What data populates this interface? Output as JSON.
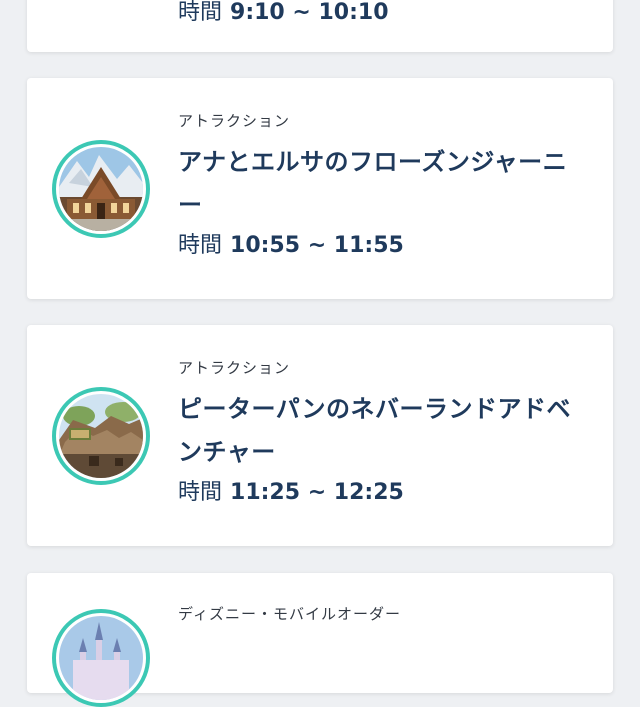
{
  "schedule": {
    "items": [
      {
        "time_label": "時間",
        "time_value": "9:10 ~ 10:10"
      },
      {
        "category": "アトラクション",
        "title": "アナとエルサのフローズンジャーニー",
        "time_label": "時間",
        "time_value": "10:55 ~ 11:55",
        "image_icon": "frozen-castle-image"
      },
      {
        "category": "アトラクション",
        "title": "ピーターパンのネバーランドアドベンチャー",
        "time_label": "時間",
        "time_value": "11:25 ~ 12:25",
        "image_icon": "neverland-ride-image"
      },
      {
        "category": "ディズニー・モバイルオーダー",
        "image_icon": "castle-image"
      }
    ]
  },
  "colors": {
    "accent_ring": "#3cc8b4",
    "title_text": "#1f3a5c",
    "background": "#eef0f3"
  }
}
